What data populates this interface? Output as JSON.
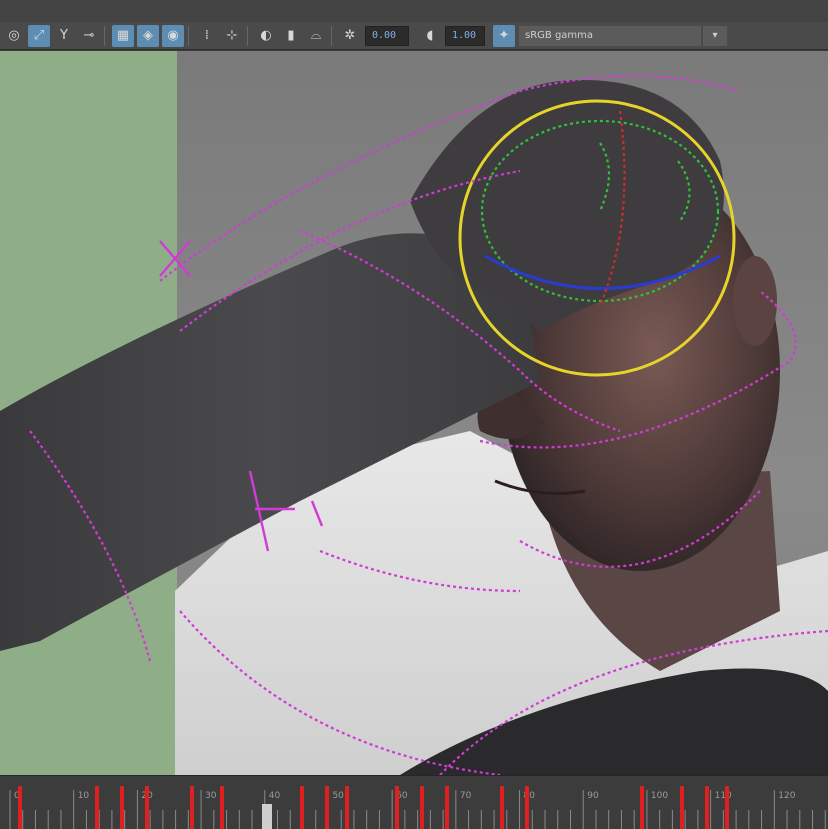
{
  "toolbar": {
    "icons": [
      "select-icon",
      "lasso-icon",
      "snap-icon",
      "camera-icon",
      "grid-icon",
      "wireframe-icon",
      "shaded-icon",
      "light-icon",
      "isolate-icon",
      "xray-icon",
      "texture-icon",
      "shadow-icon",
      "aa-icon",
      "gamma-icon",
      "exposure-icon"
    ],
    "exposure_value": "0.00",
    "gamma_value": "1.00",
    "colorspace_label": "sRGB gamma"
  },
  "colors": {
    "controller_magenta": "#d23ad6",
    "controller_yellow": "#e7d42a",
    "controller_green": "#2fbf3a",
    "controller_blue": "#2a3bd0",
    "controller_red": "#d02a2a",
    "keyframe_red": "#e02020",
    "accent_blue": "#5d8db3"
  },
  "timeline": {
    "tick_labels": [
      "0",
      "10",
      "20",
      "30",
      "40",
      "50",
      "60",
      "70",
      "80",
      "90",
      "100",
      "110",
      "120"
    ],
    "keyframes": [
      18,
      95,
      120,
      145,
      190,
      220,
      300,
      325,
      345,
      395,
      420,
      445,
      500,
      525,
      640,
      680,
      705,
      725
    ]
  }
}
